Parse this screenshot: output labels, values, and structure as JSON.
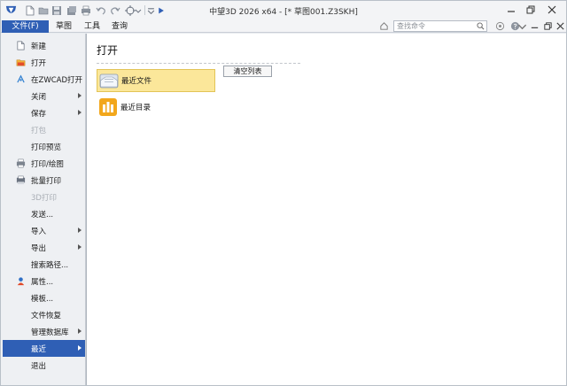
{
  "window": {
    "title": "中望3D 2026 x64 - [* 草图001.Z3SKH]"
  },
  "menubar": {
    "items": [
      {
        "label": "文件(F)"
      },
      {
        "label": "草图"
      },
      {
        "label": "工具"
      },
      {
        "label": "查询"
      }
    ],
    "search_placeholder": "查找命令"
  },
  "sidebar": {
    "items": [
      {
        "label": "新建",
        "icon": "new-document-icon"
      },
      {
        "label": "打开",
        "icon": "open-folder-icon"
      },
      {
        "label": "在ZWCAD打开",
        "icon": "zwcad-icon"
      },
      {
        "label": "关闭",
        "has_submenu": true
      },
      {
        "label": "保存",
        "has_submenu": true
      },
      {
        "label": "打包",
        "disabled": true
      },
      {
        "label": "打印预览"
      },
      {
        "label": "打印/绘图",
        "icon": "printer-icon"
      },
      {
        "label": "批量打印",
        "icon": "batch-print-icon"
      },
      {
        "label": "3D打印",
        "disabled": true
      },
      {
        "label": "发送..."
      },
      {
        "label": "导入",
        "has_submenu": true
      },
      {
        "label": "导出",
        "has_submenu": true
      },
      {
        "label": "搜索路径..."
      },
      {
        "label": "属性...",
        "icon": "properties-icon"
      },
      {
        "label": "模板..."
      },
      {
        "label": "文件恢复"
      },
      {
        "label": "管理数据库",
        "has_submenu": true
      },
      {
        "label": "最近",
        "has_submenu": true,
        "selected": true
      },
      {
        "label": "退出"
      }
    ]
  },
  "main": {
    "title": "打开",
    "options": [
      {
        "label": "最近文件",
        "icon": "recent-files-icon",
        "active": true
      },
      {
        "label": "最近目录",
        "icon": "recent-folders-icon",
        "active": false
      }
    ],
    "clear_label": "清空列表"
  },
  "colors": {
    "accent": "#2f5fb5",
    "highlight": "#fbe79a",
    "highlight_border": "#e2c457"
  }
}
